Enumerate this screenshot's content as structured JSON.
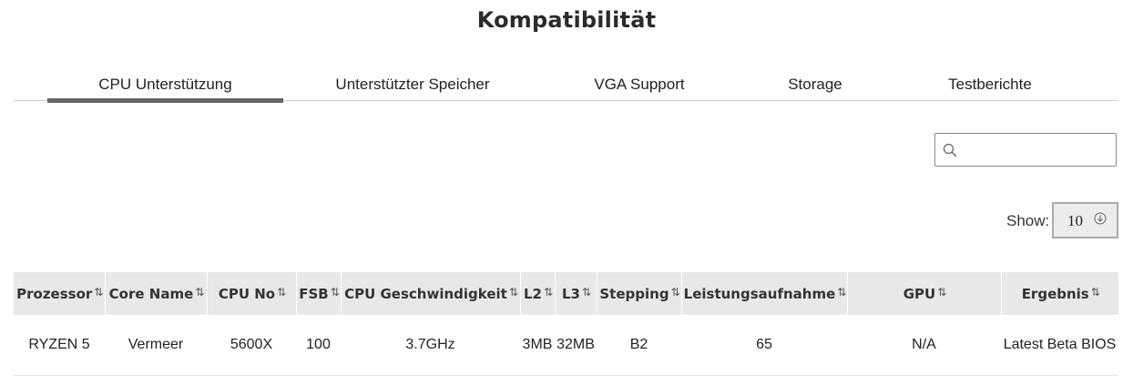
{
  "page": {
    "title": "Kompatibilität"
  },
  "tabs": [
    {
      "label": "CPU Unterstützung",
      "active": true
    },
    {
      "label": "Unterstützter Speicher",
      "active": false
    },
    {
      "label": "VGA Support",
      "active": false
    },
    {
      "label": "Storage",
      "active": false
    },
    {
      "label": "Testberichte",
      "active": false
    }
  ],
  "search": {
    "value": "",
    "placeholder": "",
    "icon": "search-icon"
  },
  "show": {
    "label": "Show:",
    "selected": "10",
    "icon": "chevron-down-circle-icon"
  },
  "table": {
    "columns": [
      "Prozessor",
      "Core Name",
      "CPU No",
      "FSB",
      "CPU Geschwindigkeit",
      "L2",
      "L3",
      "Stepping",
      "Leistungsaufnahme",
      "GPU",
      "Ergebnis"
    ],
    "sort_icon": "⇅",
    "rows": [
      [
        "RYZEN 5",
        "Vermeer",
        "5600X",
        "100",
        "3.7GHz",
        "3MB",
        "32MB",
        "B2",
        "65",
        "N/A",
        "Latest Beta BIOS"
      ]
    ]
  },
  "colors": {
    "header_bg": "#e8e8e8",
    "tab_underline": "#666666",
    "select_bg": "#ececec"
  }
}
